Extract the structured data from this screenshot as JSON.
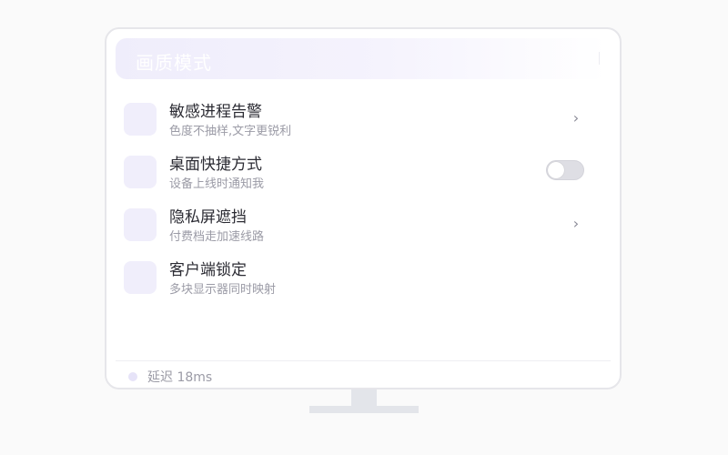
{
  "header": {
    "title": "画质模式"
  },
  "settings": [
    {
      "title": "敏感进程告警",
      "subtitle": "色度不抽样,文字更锐利",
      "control": "chevron",
      "chevron_glyph": "›"
    },
    {
      "title": "桌面快捷方式",
      "subtitle": "设备上线时通知我",
      "control": "toggle",
      "toggle_on": false
    },
    {
      "title": "隐私屏遮挡",
      "subtitle": "付费档走加速线路",
      "control": "chevron",
      "chevron_glyph": "›"
    },
    {
      "title": "客户端锁定",
      "subtitle": "多块显示器同时映射",
      "control": "none"
    }
  ],
  "status": {
    "latency_text": "延迟 18ms"
  },
  "colors": {
    "accent_tint": "#f0eefb",
    "toggle_off": "#dedee4",
    "text_primary": "#2b2b33",
    "text_secondary": "#9b9ba6"
  }
}
